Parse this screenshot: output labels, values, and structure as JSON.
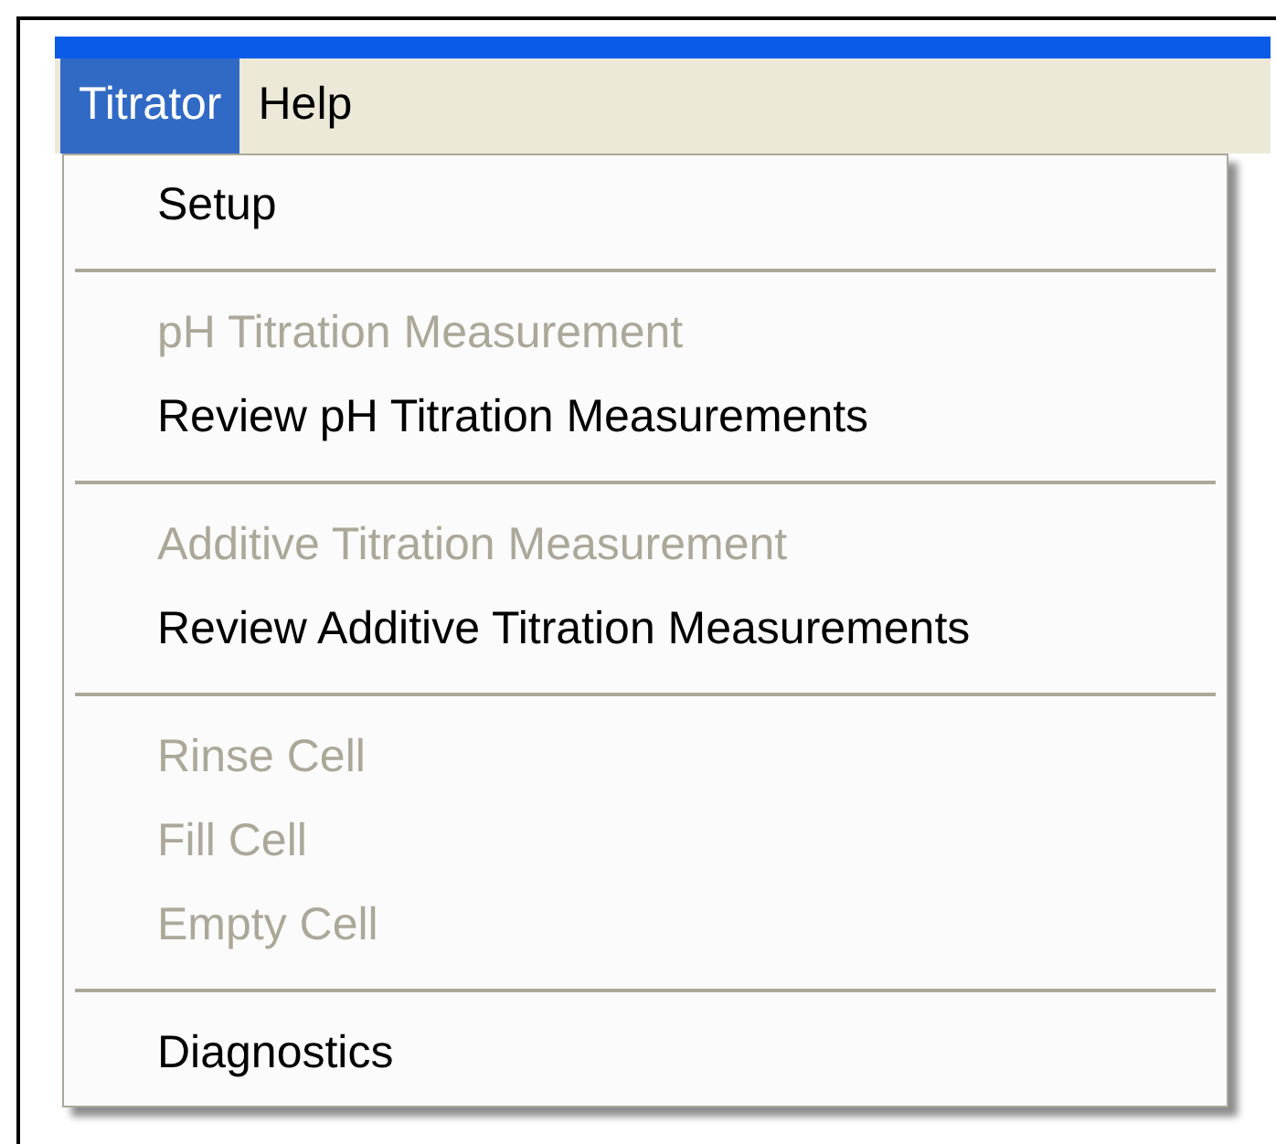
{
  "menu_bar": [
    {
      "label": "Titrator",
      "selected": true
    },
    {
      "label": "Help",
      "selected": false
    }
  ],
  "menu": [
    {
      "kind": "item",
      "label": "Setup",
      "disabled": false
    },
    {
      "kind": "separator"
    },
    {
      "kind": "item",
      "label": "pH Titration Measurement",
      "disabled": true
    },
    {
      "kind": "item",
      "label": "Review pH Titration Measurements",
      "disabled": false
    },
    {
      "kind": "separator"
    },
    {
      "kind": "item",
      "label": "Additive Titration Measurement",
      "disabled": true
    },
    {
      "kind": "item",
      "label": "Review Additive Titration Measurements",
      "disabled": false
    },
    {
      "kind": "separator"
    },
    {
      "kind": "item",
      "label": "Rinse Cell",
      "disabled": true
    },
    {
      "kind": "item",
      "label": "Fill Cell",
      "disabled": true
    },
    {
      "kind": "item",
      "label": "Empty Cell",
      "disabled": true
    },
    {
      "kind": "separator"
    },
    {
      "kind": "item",
      "label": "Diagnostics",
      "disabled": false
    }
  ]
}
